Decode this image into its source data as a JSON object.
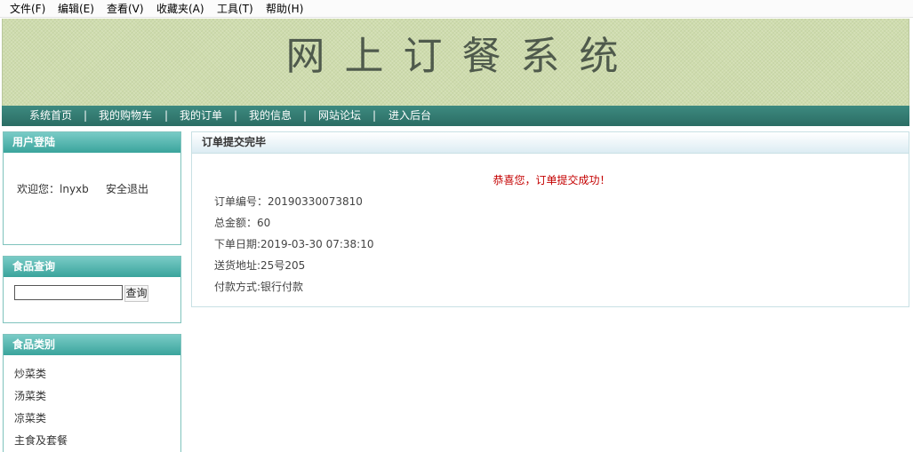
{
  "menu": [
    "文件(F)",
    "编辑(E)",
    "查看(V)",
    "收藏夹(A)",
    "工具(T)",
    "帮助(H)"
  ],
  "banner": {
    "title": "网上订餐系统"
  },
  "nav": [
    "系统首页",
    "我的购物车",
    "我的订单",
    "我的信息",
    "网站论坛",
    "进入后台"
  ],
  "nav_separator": "|",
  "login_panel": {
    "title": "用户登陆",
    "welcome": "欢迎您：lnyxb",
    "logout": "安全退出"
  },
  "search_panel": {
    "title": "食品查询",
    "input_value": "",
    "button": "查询"
  },
  "category_panel": {
    "title": "食品类别",
    "items": [
      "炒菜类",
      "汤菜类",
      "凉菜类",
      "主食及套餐"
    ]
  },
  "order": {
    "title": "订单提交完毕",
    "success": "恭喜您，订单提交成功！",
    "rows": [
      "订单编号：20190330073810",
      "总金额：60",
      "下单日期:2019-03-30 07:38:10",
      "送货地址:25号205",
      "付款方式:银行付款"
    ]
  },
  "colors": {
    "nav": "#2f756c",
    "panel_header": "#3aa49c",
    "success": "#c40000",
    "banner": "#cfdcae"
  }
}
